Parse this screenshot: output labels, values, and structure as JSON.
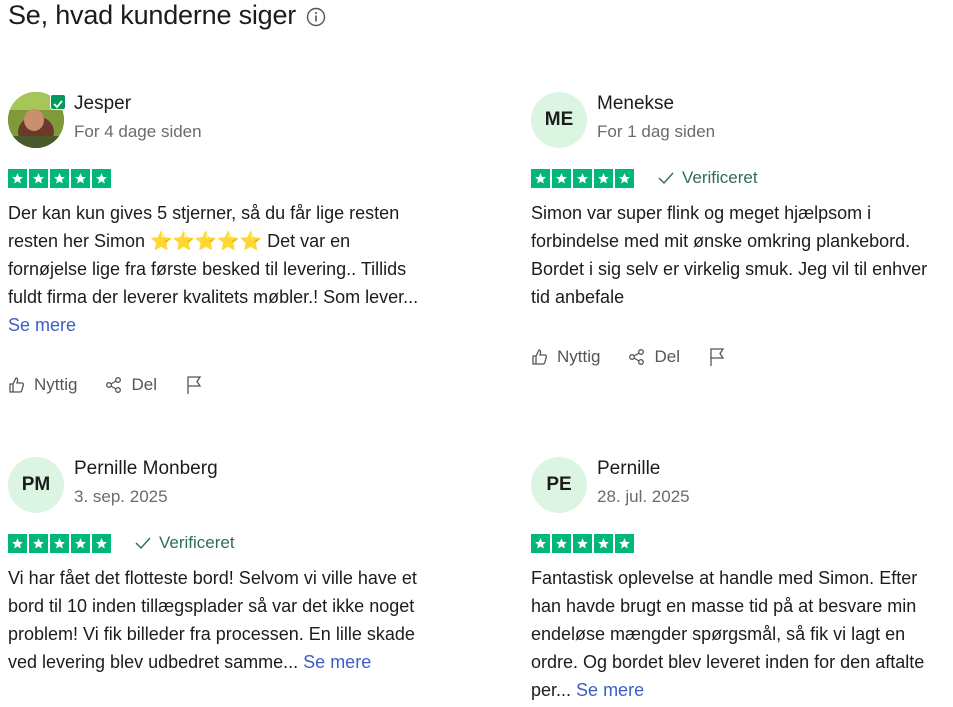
{
  "section_title": "Se, hvad kunderne siger",
  "colors": {
    "star_green": "#00b67a",
    "link": "#3b5fc7",
    "verified": "#2f6f4f"
  },
  "labels": {
    "helpful": "Nyttig",
    "share": "Del",
    "see_more": "Se mere",
    "verified": "Verificeret"
  },
  "reviews": [
    {
      "name": "Jesper",
      "date": "For 4 dage siden",
      "avatar": {
        "type": "photo",
        "initials": ""
      },
      "rating": 5,
      "verified": false,
      "text": "Der kan kun gives 5 stjerner, så du får lige resten resten her Simon ⭐⭐⭐⭐⭐ Det var en fornøjelse lige fra første besked til levering.. Tillids fuldt firma der leverer kvalitets møbler.! Som lever...",
      "truncated": true
    },
    {
      "name": "Menekse",
      "date": "For 1 dag siden",
      "avatar": {
        "type": "initials",
        "initials": "ME"
      },
      "rating": 5,
      "verified": true,
      "text": "Simon var super flink og meget hjælpsom i forbindelse med mit ønske omkring plankebord. Bordet i sig selv er virkelig smuk. Jeg vil til enhver tid anbefale",
      "truncated": false
    },
    {
      "name": "Pernille Monberg",
      "date": "3. sep. 2025",
      "avatar": {
        "type": "initials",
        "initials": "PM"
      },
      "rating": 5,
      "verified": true,
      "text": "Vi har fået det flotteste bord! Selvom vi ville have et bord til 10 inden tillægsplader så var det ikke noget problem! Vi fik billeder fra processen. En lille skade ved levering blev udbedret samme...",
      "truncated": true
    },
    {
      "name": "Pernille",
      "date": "28. jul. 2025",
      "avatar": {
        "type": "initials",
        "initials": "PE"
      },
      "rating": 5,
      "verified": false,
      "text": "Fantastisk oplevelse at handle med Simon. Efter han havde brugt en masse tid på at besvare min endeløse mængder spørgsmål, så fik vi lagt en ordre. Og bordet blev leveret inden for den aftalte per...",
      "truncated": true
    }
  ]
}
